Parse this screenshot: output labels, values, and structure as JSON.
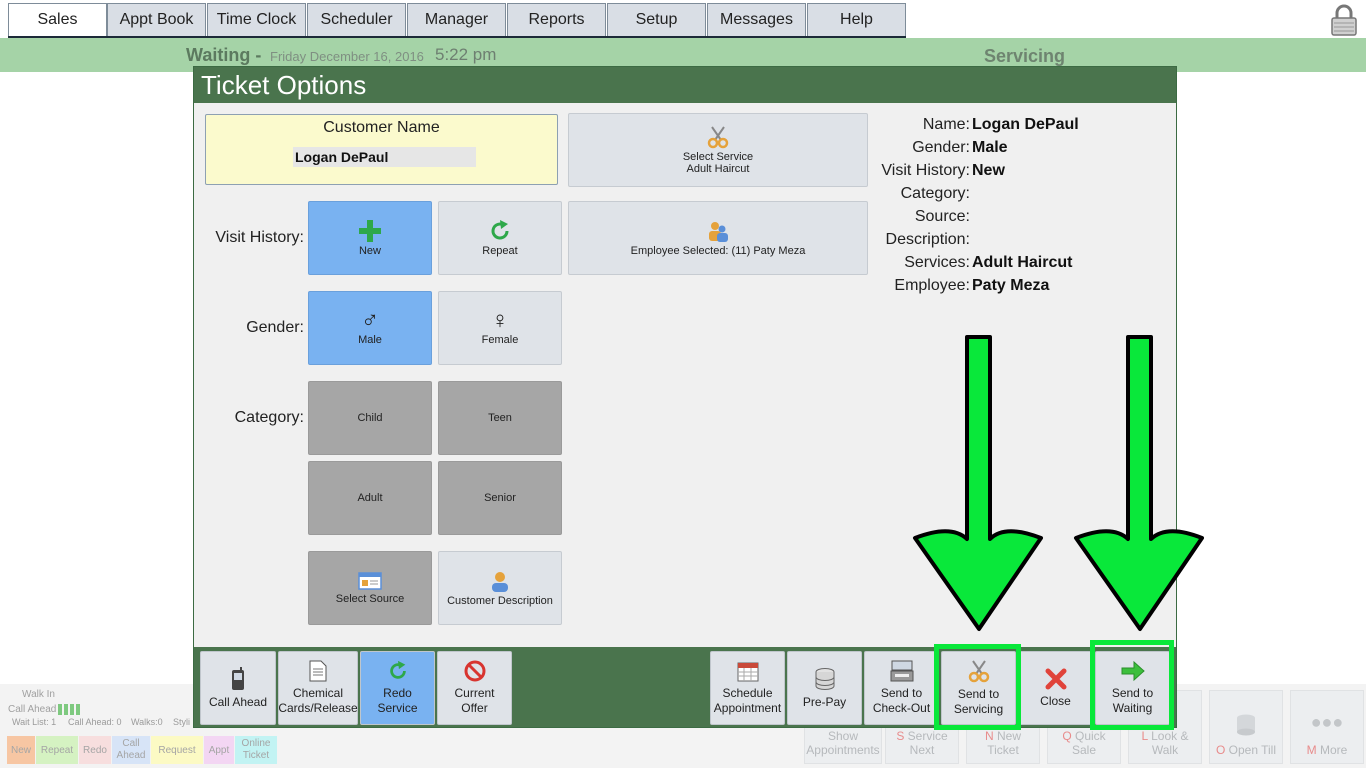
{
  "nav": {
    "tabs": [
      "Sales",
      "Appt Book",
      "Time Clock",
      "Scheduler",
      "Manager",
      "Reports",
      "Setup",
      "Messages",
      "Help"
    ],
    "active": "Sales"
  },
  "status": {
    "waiting_label": "Waiting -",
    "date": "Friday December 16, 2016",
    "time": "5:22 pm",
    "servicing_label": "Servicing"
  },
  "modal": {
    "title": "Ticket Options",
    "customer": {
      "label": "Customer Name",
      "value": "Logan DePaul"
    },
    "service_button": {
      "line1": "Select Service",
      "line2": "Adult Haircut"
    },
    "employee_button": {
      "label": "Employee Selected: (11) Paty Meza"
    },
    "visit_history": {
      "label": "Visit History:",
      "new": "New",
      "repeat": "Repeat"
    },
    "gender": {
      "label": "Gender:",
      "male": "Male",
      "female": "Female"
    },
    "category": {
      "label": "Category:",
      "child": "Child",
      "teen": "Teen",
      "adult": "Adult",
      "senior": "Senior"
    },
    "select_source": "Select Source",
    "customer_description": "Customer Description",
    "info": {
      "name_k": "Name:",
      "name_v": "Logan DePaul",
      "gender_k": "Gender:",
      "gender_v": "Male",
      "visit_k": "Visit History:",
      "visit_v": "New",
      "category_k": "Category:",
      "source_k": "Source:",
      "description_k": "Description:",
      "services_k": "Services:",
      "services_v": "Adult Haircut",
      "employee_k": "Employee:",
      "employee_v": "Paty Meza"
    },
    "footer": {
      "call_ahead": "Call Ahead",
      "chemical_1": "Chemical",
      "chemical_2": "Cards/Release",
      "redo_1": "Redo",
      "redo_2": "Service",
      "offer_1": "Current",
      "offer_2": "Offer",
      "schedule_1": "Schedule",
      "schedule_2": "Appointment",
      "prepay": "Pre-Pay",
      "checkout_1": "Send to",
      "checkout_2": "Check-Out",
      "servicing_1": "Send to",
      "servicing_2": "Servicing",
      "close": "Close",
      "waiting_1": "Send to",
      "waiting_2": "Waiting"
    }
  },
  "background": {
    "walk_in": "Walk In",
    "call_ahead": "Call Ahead",
    "wait_list": "Wait List: 1",
    "call_ahead_count": "Call Ahead: 0",
    "walks": "Walks:0",
    "styl": "Styli",
    "legend": {
      "new": "New",
      "repeat": "Repeat",
      "redo": "Redo",
      "call_1": "Call",
      "call_2": "Ahead",
      "request": "Request",
      "appt": "Appt",
      "online_1": "Online",
      "online_2": "Ticket"
    },
    "buttons": {
      "show_1": "Show",
      "show_2": "Appointments",
      "service_k": "S",
      "service_1": "Service",
      "service_2": "Next",
      "new_k": "N",
      "new_1": "New",
      "new_2": "Ticket",
      "quick_k": "Q",
      "quick_1": "Quick",
      "quick_2": "Sale",
      "look_k": "L",
      "look_1": "Look &",
      "look_2": "Walk",
      "till_k": "O",
      "till": "Open Till",
      "more_k": "M",
      "more": "More"
    }
  },
  "colors": {
    "header_green": "#4a744d",
    "status_green": "#a5d3a7",
    "selected_blue": "#79b2f1",
    "highlight_green": "#09e83a"
  }
}
